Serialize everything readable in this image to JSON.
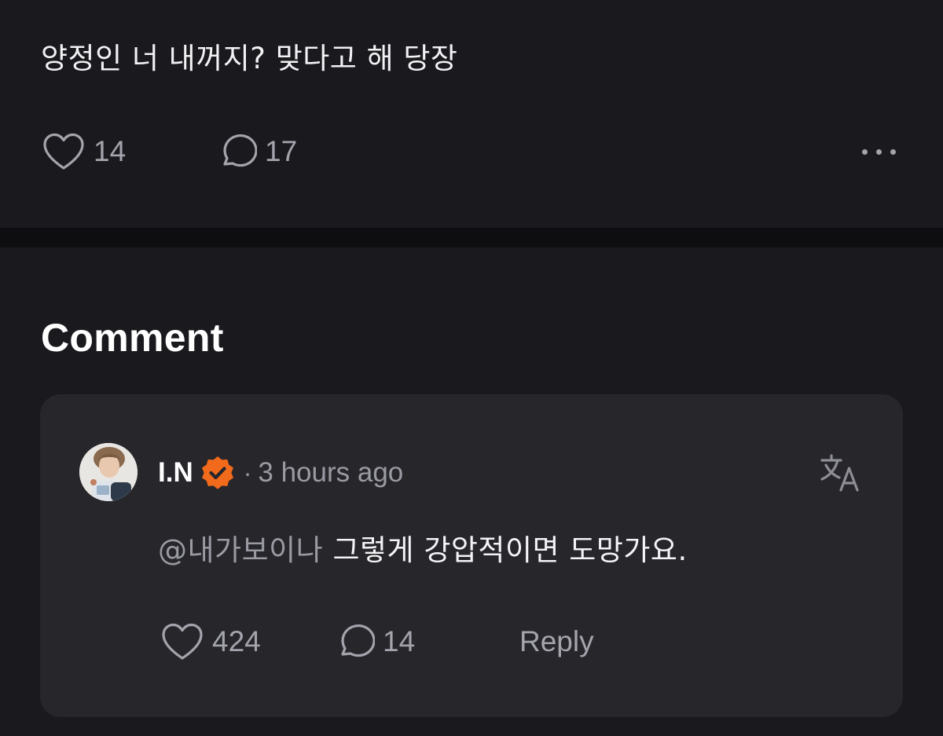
{
  "post": {
    "text": "양정인 너 내꺼지? 맞다고 해 당장",
    "like_count": "14",
    "comment_count": "17"
  },
  "comments_section": {
    "title": "Comment"
  },
  "comment": {
    "username": "I.N",
    "separator": "·",
    "time": "3 hours ago",
    "mention": "@내가보이나",
    "text": "그렇게 강압적이면 도망가요.",
    "like_count": "424",
    "reply_count": "14",
    "reply_label": "Reply"
  },
  "colors": {
    "background": "#1a1a1e",
    "card": "#26262b",
    "divider": "#0e0e10",
    "muted": "#a4a4ac",
    "verified_badge": "#f26a1b"
  },
  "icons": {
    "like": "heart-icon",
    "comment": "speech-bubble-icon",
    "more": "more-dots-icon",
    "verified": "verified-badge-icon",
    "translate": "translate-icon"
  }
}
